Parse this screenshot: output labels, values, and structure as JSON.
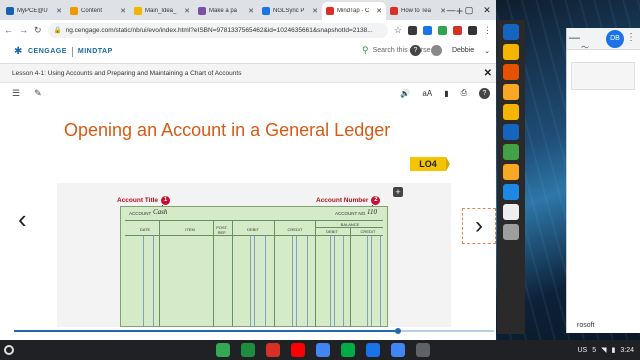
{
  "browser": {
    "tabs": [
      {
        "title": "MyPCE@U",
        "color": "#1a5fb4",
        "active": false
      },
      {
        "title": "Content",
        "color": "#f29900",
        "active": false
      },
      {
        "title": "Main_Idea_",
        "color": "#f2b600",
        "active": false
      },
      {
        "title": "Make a pa",
        "color": "#7b4fa0",
        "active": false
      },
      {
        "title": "NGLSync P",
        "color": "#1a73e8",
        "active": false
      },
      {
        "title": "MindTap - C",
        "color": "#d93025",
        "active": true
      },
      {
        "title": "How to Tea",
        "color": "#d93025",
        "active": false
      }
    ],
    "url": "ng.cengage.com/static/nb/ui/evo/index.html?eISBN=9781337565462&id=1024635661&snapshotId=2138...",
    "new_tab_glyph": "+",
    "ext_colors": [
      "#3a3a3a",
      "#1a73e8",
      "#2ea44f",
      "#d93025",
      "#333333"
    ]
  },
  "mindtap": {
    "brand": "CENGAGE",
    "product": "MINDTAP",
    "search_placeholder": "Search this course",
    "user": "Debbie",
    "lesson_title": "Lesson 4-1: Using Accounts and Preparing and Maintaining a Chart of Accounts"
  },
  "slide": {
    "heading": "Opening an Account in a General Ledger",
    "badge": "LO4",
    "callouts": [
      {
        "label": "Account Title",
        "num": "1"
      },
      {
        "label": "Account Number",
        "num": "2"
      }
    ],
    "ledger": {
      "account_label": "ACCOUNT",
      "account_name": "Cash",
      "account_no_label": "ACCOUNT NO.",
      "account_no": "110",
      "columns": [
        "DATE",
        "ITEM",
        "POST. REF.",
        "DEBIT",
        "CREDIT",
        "BALANCE",
        "DEBIT",
        "CREDIT"
      ]
    }
  },
  "progress": {
    "fraction": 0.8
  },
  "second_window": {
    "avatar": "DB",
    "footer": "rosoft"
  },
  "taskbar": {
    "apps": [
      {
        "name": "chrome",
        "color": "#34a853"
      },
      {
        "name": "classroom",
        "color": "#1e8e3e"
      },
      {
        "name": "gmail",
        "color": "#d93025"
      },
      {
        "name": "youtube",
        "color": "#ff0000"
      },
      {
        "name": "play-store",
        "color": "#4285f4"
      },
      {
        "name": "chat",
        "color": "#00ac47"
      },
      {
        "name": "files",
        "color": "#1a73e8"
      },
      {
        "name": "docs",
        "color": "#4285f4"
      },
      {
        "name": "calendar",
        "color": "#5f6368"
      }
    ],
    "locale": "US",
    "battery": "5",
    "time": "3:24"
  },
  "dock_colors": [
    "#1565c0",
    "#f4b400",
    "#e65100",
    "#f9a825",
    "#f4b400",
    "#1565c0",
    "#43a047",
    "#f9a825",
    "#1e88e5",
    "#eeeeee",
    "#9e9e9e"
  ]
}
